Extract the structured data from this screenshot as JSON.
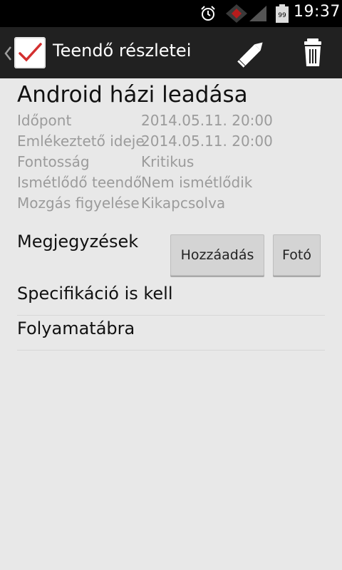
{
  "status_bar": {
    "time": "19:37",
    "battery_level": "99",
    "icons": [
      "alarm-icon",
      "sim-icon",
      "signal-icon",
      "battery-icon"
    ]
  },
  "action_bar": {
    "title": "Teendő részletei",
    "icons": [
      "up-chevron-icon",
      "checkmark-app-icon",
      "pencil-icon",
      "trash-icon"
    ]
  },
  "task": {
    "title": "Android házi leadása",
    "details": [
      {
        "label": "Időpont",
        "value": "2014.05.11. 20:00"
      },
      {
        "label": "Emlékeztető ideje",
        "value": "2014.05.11. 20:00"
      },
      {
        "label": "Fontosság",
        "value": "Kritikus"
      },
      {
        "label": "Ismétlődő teendő",
        "value": "Nem ismétlődik"
      },
      {
        "label": "Mozgás figyelése",
        "value": "Kikapcsolva"
      }
    ]
  },
  "notes": {
    "label": "Megjegyzések",
    "add_button": "Hozzáadás",
    "photo_button": "Fotó",
    "items": [
      "Specifikáció is kell",
      "Folyamatábra"
    ]
  },
  "colors": {
    "background": "#e8e8e8",
    "action_bar": "#212121",
    "status_bar": "#000000",
    "detail_text": "#9b9b9b",
    "check_red": "#d32f2f"
  }
}
